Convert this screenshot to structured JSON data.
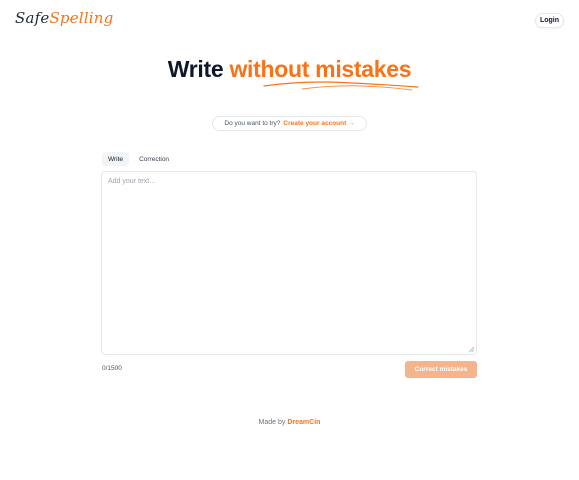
{
  "header": {
    "logo_part1": "Safe",
    "logo_part2": "Spelling",
    "login_label": "Login"
  },
  "hero": {
    "title_plain": "Write ",
    "title_accent": "without mistakes"
  },
  "promo": {
    "question": "Do you want to try?",
    "link_label": "Create your account →"
  },
  "tabs": [
    {
      "label": "Write",
      "active": true
    },
    {
      "label": "Correction",
      "active": false
    }
  ],
  "editor": {
    "placeholder": "Add your text...",
    "value": ""
  },
  "counter": "0/1500",
  "actions": {
    "correct_label": "Correct mistakes"
  },
  "footer": {
    "prefix": "Made by",
    "brand": "DreamCin"
  },
  "colors": {
    "accent": "#f97316",
    "button_disabled": "#f6b48c",
    "heading": "#0f1729"
  }
}
